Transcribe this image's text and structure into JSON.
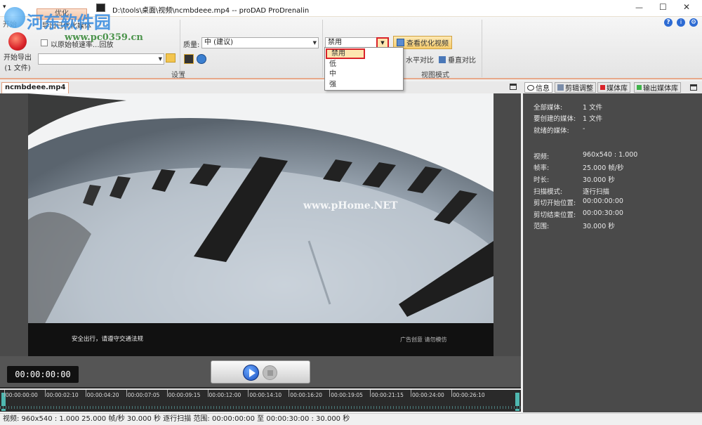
{
  "titlebar": {
    "menu_glyph": "▾",
    "title": "D:\\tools\\桌面\\视频\\ncmbdeee.mp4 -- proDAD ProDrenalin",
    "minimize": "—",
    "maximize": "☐",
    "close": "✕"
  },
  "watermark": {
    "logo_text": "河东软件园",
    "url_text": "www.pc0359.cn",
    "video_overlay": "www.pHome.NET"
  },
  "ribbon": {
    "tab_active": "优化",
    "tab_left_partial": "开始",
    "tab_partial": "导出已优化媒体",
    "export_button": {
      "line1": "开始导出",
      "line2": "(1 文件)"
    },
    "checkbox_label": "以原始帧速率...回放",
    "path_value": "",
    "group_settings_label": "设置",
    "quality_label": "质量:",
    "quality_value": "中  (建议)",
    "optimize_value": "禁用",
    "view_optimized_button": "查看优化视频",
    "horizontal_compare": "水平对比",
    "vertical_compare": "垂直对比",
    "group_view_mode_label": "视图模式"
  },
  "dropdown": {
    "options": [
      "禁用",
      "低",
      "中",
      "强"
    ],
    "selected": "禁用"
  },
  "video": {
    "tab_label": "ncmbdeee.mp4",
    "subtitle_left": "安全出行，请遵守交通法规",
    "subtitle_right": "广告创意 请勿模仿"
  },
  "transport": {
    "timecode": "00:00:00:00"
  },
  "timeline": {
    "labels": [
      "00:00:00:00",
      "00:00:02:10",
      "00:00:04:20",
      "00:00:07:05",
      "00:00:09:15",
      "00:00:12:00",
      "00:00:14:10",
      "00:00:16:20",
      "00:00:19:05",
      "00:00:21:15",
      "00:00:24:00",
      "00:00:26:10"
    ]
  },
  "right_panel": {
    "tabs": [
      {
        "label": "信息",
        "icon": "speech-bubble-icon"
      },
      {
        "label": "剪辑调整",
        "icon": "tools-icon"
      },
      {
        "label": "媒体库",
        "icon": "red-square-icon"
      },
      {
        "label": "输出媒体库",
        "icon": "green-square-icon"
      }
    ],
    "info": [
      {
        "k": "全部媒体:",
        "v": "1 文件"
      },
      {
        "k": "要创建的媒体:",
        "v": "1 文件"
      },
      {
        "k": "就绪的媒体:",
        "v": "-"
      },
      {
        "k": "视频:",
        "v": "960x540 : 1.000"
      },
      {
        "k": "帧率:",
        "v": "25.000 帧/秒"
      },
      {
        "k": "时长:",
        "v": "30.000 秒"
      },
      {
        "k": "扫描模式:",
        "v": "逐行扫描"
      },
      {
        "k": "剪切开始位置:",
        "v": "00:00:00:00"
      },
      {
        "k": "剪切结束位置:",
        "v": "00:00:30:00"
      },
      {
        "k": "范围:",
        "v": "30.000 秒"
      }
    ]
  },
  "statusbar": {
    "text": "视频: 960x540 : 1.000   25.000 帧/秒   30.000 秒   逐行扫描   范围: 00:00:00:00 至 00:00:30:00 : 30.000 秒"
  },
  "colors": {
    "accent_red": "#d9232a",
    "ribbon_accent": "#e8a88a",
    "dark_panel": "#4a4a4a"
  }
}
